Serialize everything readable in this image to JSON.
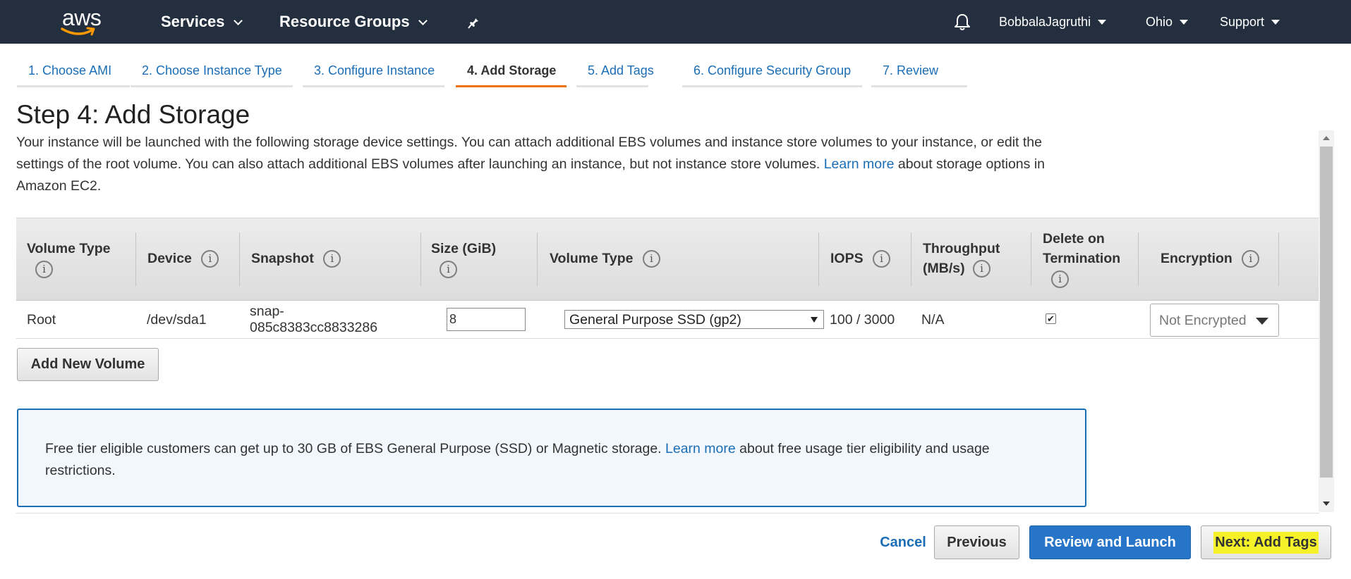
{
  "nav": {
    "logo_text": "aws",
    "services": "Services",
    "resource_groups": "Resource Groups",
    "user": "BobbalaJagruthi",
    "region": "Ohio",
    "support": "Support"
  },
  "tabs": [
    {
      "label": "1. Choose AMI"
    },
    {
      "label": "2. Choose Instance Type"
    },
    {
      "label": "3. Configure Instance"
    },
    {
      "label": "4. Add Storage"
    },
    {
      "label": "5. Add Tags"
    },
    {
      "label": "6. Configure Security Group"
    },
    {
      "label": "7. Review"
    }
  ],
  "page": {
    "title": "Step 4: Add Storage",
    "intro_text": "Your instance will be launched with the following storage device settings. You can attach additional EBS volumes and instance store volumes to your instance, or edit the settings of the root volume. You can also attach additional EBS volumes after launching an instance, but not instance store volumes.",
    "learn_more": "Learn more",
    "intro_tail": "about storage options in Amazon EC2."
  },
  "table": {
    "headers": {
      "volume_type": "Volume Type",
      "device": "Device",
      "snapshot": "Snapshot",
      "size_line1": "Size (GiB)",
      "volume_type2": "Volume Type",
      "iops": "IOPS",
      "throughput_line1": "Throughput",
      "throughput_line2": "(MB/s)",
      "delete_line1": "Delete on",
      "delete_line2": "Termination",
      "encryption": "Encryption"
    },
    "row": {
      "volume_type": "Root",
      "device": "/dev/sda1",
      "snapshot_line1": "snap-",
      "snapshot_line2": "085c8383cc8833286",
      "size": "8",
      "ebs_type": "General Purpose SSD (gp2)",
      "iops": "100 / 3000",
      "throughput": "N/A",
      "delete_on_termination": true,
      "encryption": "Not Encrypted"
    }
  },
  "add_volume_label": "Add New Volume",
  "notice": {
    "text_before": "Free tier eligible customers can get up to 30 GB of EBS General Purpose (SSD) or Magnetic storage.",
    "link": "Learn more",
    "text_after": "about free usage tier eligibility and usage restrictions."
  },
  "footer": {
    "cancel": "Cancel",
    "previous": "Previous",
    "review_launch": "Review and Launch",
    "next": "Next: Add Tags"
  },
  "colors": {
    "nav_bg": "#232f3e",
    "link_blue": "#1b6eb5",
    "active_tab_orange": "#ec7211",
    "primary_button": "#2775c8",
    "highlight_yellow": "#f5f22a"
  }
}
